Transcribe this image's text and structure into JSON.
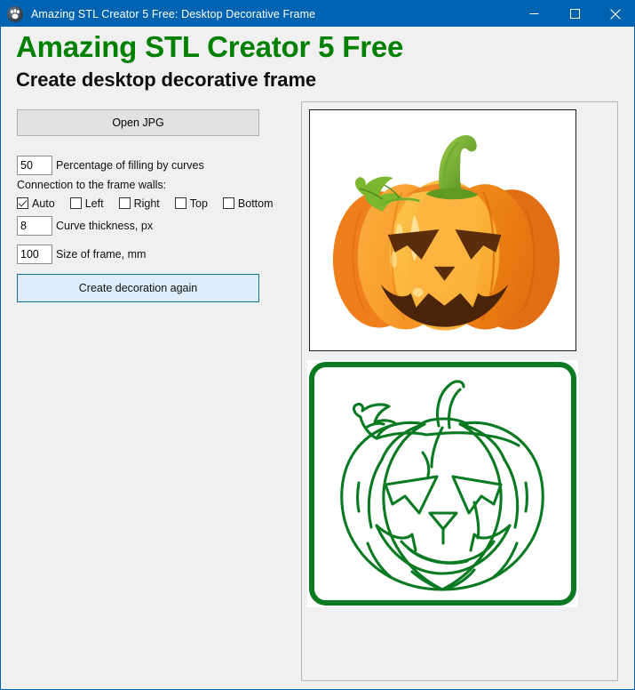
{
  "window": {
    "title": "Amazing STL Creator 5 Free: Desktop Decorative Frame",
    "icon": "paw-app-icon",
    "accent_color": "#0063b1",
    "background_color": "#f0f0f0",
    "controls": {
      "minimize": "minimize-icon",
      "maximize": "maximize-icon",
      "close": "close-icon"
    }
  },
  "header": {
    "app_title": "Amazing STL Creator 5 Free",
    "app_title_color": "#008000",
    "subtitle": "Create desktop decorative frame",
    "subtitle_color": "#101010"
  },
  "controls": {
    "open_jpg_label": "Open JPG",
    "fill_percentage": {
      "value": "50",
      "label": "Percentage of filling by curves"
    },
    "connection_group_label": "Connection to the frame walls:",
    "connection_options": [
      {
        "label": "Auto",
        "checked": true
      },
      {
        "label": "Left",
        "checked": false
      },
      {
        "label": "Right",
        "checked": false
      },
      {
        "label": "Top",
        "checked": false
      },
      {
        "label": "Bottom",
        "checked": false
      }
    ],
    "curve_thickness": {
      "value": "8",
      "label": "Curve thickness, px"
    },
    "frame_size": {
      "value": "100",
      "label": "Size of frame, mm"
    },
    "create_button_label": "Create decoration again",
    "create_button_color": "#ddeefa",
    "create_button_border": "#1a7099"
  },
  "preview": {
    "source_image": "jack-o-lantern-pumpkin-photo",
    "output_image": "jack-o-lantern-green-outline-frame",
    "outline_color": "#0a7a22",
    "pumpkin_colors": {
      "body_light": "#fbb040",
      "body_mid": "#f7941e",
      "body_dark": "#ef7f1a",
      "body_deep": "#e06e14",
      "highlight": "#fdd15c",
      "stem_light": "#8cc63f",
      "stem_dark": "#4f8a1e",
      "face": "#5a2d0c"
    }
  }
}
